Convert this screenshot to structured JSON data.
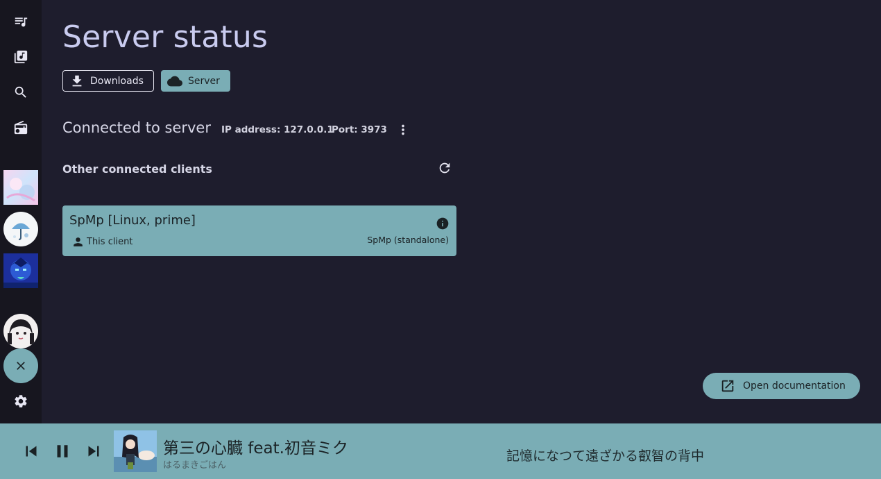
{
  "sidebar": {
    "items": [
      {
        "icon": "queue-music-icon"
      },
      {
        "icon": "library-music-icon"
      },
      {
        "icon": "search-icon"
      },
      {
        "icon": "radio-icon"
      }
    ],
    "pinned": [
      {
        "icon": "pastel-artwork-thumbnail"
      },
      {
        "icon": "umbrella-artwork-thumbnail"
      },
      {
        "icon": "blue-portrait-thumbnail"
      },
      {
        "icon": "avatar"
      }
    ],
    "close_icon": "close-icon",
    "settings_icon": "gear-icon"
  },
  "page": {
    "title": "Server status"
  },
  "tabs": [
    {
      "label": "Downloads",
      "icon": "download-icon",
      "selected": false
    },
    {
      "label": "Server",
      "icon": "cloud-icon",
      "selected": true
    }
  ],
  "connection": {
    "title": "Connected to server",
    "ip": "IP address: 127.0.0.1",
    "port": "Port: 3973"
  },
  "clients": {
    "label": "Other connected clients",
    "items": [
      {
        "name": "SpMp [Linux, prime]",
        "note": "This client",
        "type": "SpMp (standalone)"
      }
    ]
  },
  "docs_button": {
    "label": "Open documentation",
    "icon": "open-in-new-icon"
  },
  "player": {
    "title": "第三の心臓 feat.初音ミク",
    "artist": "はるまきごはん",
    "lyric": "記憶になつて遠ざかる叡智の背中",
    "state": "playing"
  },
  "colors": {
    "background": "#1e1d2d",
    "sidebar": "#17161f",
    "accent": "#7aadb5",
    "title": "#c9cbef"
  }
}
